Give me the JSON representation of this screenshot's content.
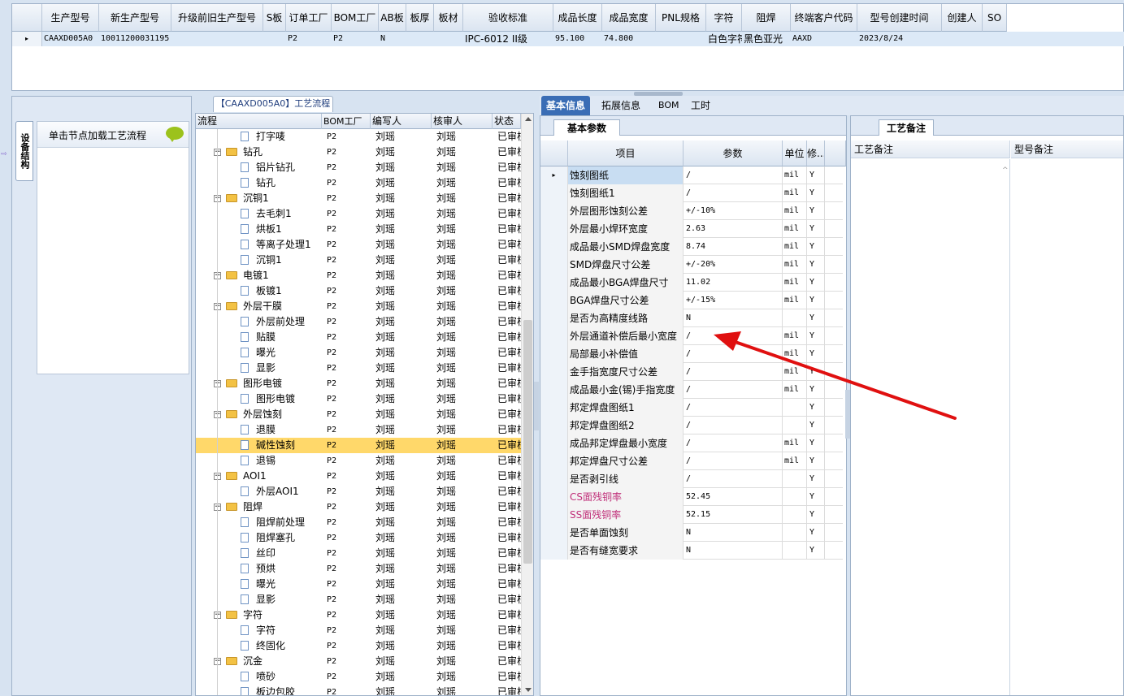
{
  "top_grid": {
    "columns": [
      "生产型号",
      "新生产型号",
      "升级前旧生产型号",
      "S板",
      "订单工厂",
      "BOM工厂",
      "AB板",
      "板厚",
      "板材",
      "验收标准",
      "成品长度",
      "成品宽度",
      "PNL规格",
      "字符",
      "阻焊",
      "终端客户代码",
      "型号创建时间",
      "创建人",
      "SO"
    ],
    "row": [
      "CAAXD005A0",
      "10011200031195",
      "",
      "",
      "P2",
      "P2",
      "N",
      "",
      "",
      "IPC-6012 II级",
      "95.100",
      "74.800",
      "",
      "白色字符",
      "黑色亚光",
      "AAXD",
      "2023/8/24",
      "",
      ""
    ]
  },
  "left_panel": {
    "vertical_tab": "设备结构",
    "hint": "单击节点加载工艺流程"
  },
  "process": {
    "title": "【CAAXD005A0】工艺流程",
    "columns": [
      "流程",
      "BOM工厂",
      "编写人",
      "核审人",
      "状态"
    ],
    "rows": [
      {
        "name": "打字唛",
        "level": 1,
        "factory": "P2",
        "writer": "刘瑶",
        "checker": "刘瑶",
        "status": "已审核"
      },
      {
        "name": "钻孔",
        "level": 0,
        "factory": "P2",
        "writer": "刘瑶",
        "checker": "刘瑶",
        "status": "已审核"
      },
      {
        "name": "铝片钻孔",
        "level": 1,
        "factory": "P2",
        "writer": "刘瑶",
        "checker": "刘瑶",
        "status": "已审核"
      },
      {
        "name": "钻孔",
        "level": 1,
        "factory": "P2",
        "writer": "刘瑶",
        "checker": "刘瑶",
        "status": "已审核"
      },
      {
        "name": "沉铜1",
        "level": 0,
        "factory": "P2",
        "writer": "刘瑶",
        "checker": "刘瑶",
        "status": "已审核"
      },
      {
        "name": "去毛刺1",
        "level": 1,
        "factory": "P2",
        "writer": "刘瑶",
        "checker": "刘瑶",
        "status": "已审核"
      },
      {
        "name": "烘板1",
        "level": 1,
        "factory": "P2",
        "writer": "刘瑶",
        "checker": "刘瑶",
        "status": "已审核"
      },
      {
        "name": "等离子处理1",
        "level": 1,
        "factory": "P2",
        "writer": "刘瑶",
        "checker": "刘瑶",
        "status": "已审核"
      },
      {
        "name": "沉铜1",
        "level": 1,
        "factory": "P2",
        "writer": "刘瑶",
        "checker": "刘瑶",
        "status": "已审核"
      },
      {
        "name": "电镀1",
        "level": 0,
        "factory": "P2",
        "writer": "刘瑶",
        "checker": "刘瑶",
        "status": "已审核"
      },
      {
        "name": "板镀1",
        "level": 1,
        "factory": "P2",
        "writer": "刘瑶",
        "checker": "刘瑶",
        "status": "已审核"
      },
      {
        "name": "外层干膜",
        "level": 0,
        "factory": "P2",
        "writer": "刘瑶",
        "checker": "刘瑶",
        "status": "已审核"
      },
      {
        "name": "外层前处理",
        "level": 1,
        "factory": "P2",
        "writer": "刘瑶",
        "checker": "刘瑶",
        "status": "已审核"
      },
      {
        "name": "贴膜",
        "level": 1,
        "factory": "P2",
        "writer": "刘瑶",
        "checker": "刘瑶",
        "status": "已审核"
      },
      {
        "name": "曝光",
        "level": 1,
        "factory": "P2",
        "writer": "刘瑶",
        "checker": "刘瑶",
        "status": "已审核"
      },
      {
        "name": "显影",
        "level": 1,
        "factory": "P2",
        "writer": "刘瑶",
        "checker": "刘瑶",
        "status": "已审核"
      },
      {
        "name": "图形电镀",
        "level": 0,
        "factory": "P2",
        "writer": "刘瑶",
        "checker": "刘瑶",
        "status": "已审核"
      },
      {
        "name": "图形电镀",
        "level": 1,
        "factory": "P2",
        "writer": "刘瑶",
        "checker": "刘瑶",
        "status": "已审核"
      },
      {
        "name": "外层蚀刻",
        "level": 0,
        "factory": "P2",
        "writer": "刘瑶",
        "checker": "刘瑶",
        "status": "已审核"
      },
      {
        "name": "退膜",
        "level": 1,
        "factory": "P2",
        "writer": "刘瑶",
        "checker": "刘瑶",
        "status": "已审核"
      },
      {
        "name": "碱性蚀刻",
        "level": 1,
        "factory": "P2",
        "writer": "刘瑶",
        "checker": "刘瑶",
        "status": "已审核",
        "selected": true
      },
      {
        "name": "退锡",
        "level": 1,
        "factory": "P2",
        "writer": "刘瑶",
        "checker": "刘瑶",
        "status": "已审核"
      },
      {
        "name": "AOI1",
        "level": 0,
        "factory": "P2",
        "writer": "刘瑶",
        "checker": "刘瑶",
        "status": "已审核"
      },
      {
        "name": "外层AOI1",
        "level": 1,
        "factory": "P2",
        "writer": "刘瑶",
        "checker": "刘瑶",
        "status": "已审核"
      },
      {
        "name": "阻焊",
        "level": 0,
        "factory": "P2",
        "writer": "刘瑶",
        "checker": "刘瑶",
        "status": "已审核"
      },
      {
        "name": "阻焊前处理",
        "level": 1,
        "factory": "P2",
        "writer": "刘瑶",
        "checker": "刘瑶",
        "status": "已审核"
      },
      {
        "name": "阻焊塞孔",
        "level": 1,
        "factory": "P2",
        "writer": "刘瑶",
        "checker": "刘瑶",
        "status": "已审核"
      },
      {
        "name": "丝印",
        "level": 1,
        "factory": "P2",
        "writer": "刘瑶",
        "checker": "刘瑶",
        "status": "已审核"
      },
      {
        "name": "预烘",
        "level": 1,
        "factory": "P2",
        "writer": "刘瑶",
        "checker": "刘瑶",
        "status": "已审核"
      },
      {
        "name": "曝光",
        "level": 1,
        "factory": "P2",
        "writer": "刘瑶",
        "checker": "刘瑶",
        "status": "已审核"
      },
      {
        "name": "显影",
        "level": 1,
        "factory": "P2",
        "writer": "刘瑶",
        "checker": "刘瑶",
        "status": "已审核"
      },
      {
        "name": "字符",
        "level": 0,
        "factory": "P2",
        "writer": "刘瑶",
        "checker": "刘瑶",
        "status": "已审核"
      },
      {
        "name": "字符",
        "level": 1,
        "factory": "P2",
        "writer": "刘瑶",
        "checker": "刘瑶",
        "status": "已审核"
      },
      {
        "name": "终固化",
        "level": 1,
        "factory": "P2",
        "writer": "刘瑶",
        "checker": "刘瑶",
        "status": "已审核"
      },
      {
        "name": "沉金",
        "level": 0,
        "factory": "P2",
        "writer": "刘瑶",
        "checker": "刘瑶",
        "status": "已审核"
      },
      {
        "name": "喷砂",
        "level": 1,
        "factory": "P2",
        "writer": "刘瑶",
        "checker": "刘瑶",
        "status": "已审核"
      },
      {
        "name": "板边包胶",
        "level": 1,
        "factory": "P2",
        "writer": "刘瑶",
        "checker": "刘瑶",
        "status": "已审核"
      }
    ]
  },
  "tabs": [
    "基本信息",
    "拓展信息",
    "BOM",
    "工时"
  ],
  "params": {
    "subtab": "基本参数",
    "columns": [
      "项目",
      "参数",
      "单位",
      "修..."
    ],
    "rows": [
      {
        "item": "蚀刻图纸",
        "value": "/",
        "unit": "mil",
        "flag": "Y"
      },
      {
        "item": "蚀刻图纸1",
        "value": "/",
        "unit": "mil",
        "flag": "Y"
      },
      {
        "item": "外层图形蚀刻公差",
        "value": "+/-10%",
        "unit": "mil",
        "flag": "Y"
      },
      {
        "item": "外层最小焊环宽度",
        "value": "2.63",
        "unit": "mil",
        "flag": "Y"
      },
      {
        "item": "成品最小SMD焊盘宽度",
        "value": "8.74",
        "unit": "mil",
        "flag": "Y"
      },
      {
        "item": "SMD焊盘尺寸公差",
        "value": "+/-20%",
        "unit": "mil",
        "flag": "Y"
      },
      {
        "item": "成品最小BGA焊盘尺寸",
        "value": "11.02",
        "unit": "mil",
        "flag": "Y"
      },
      {
        "item": "BGA焊盘尺寸公差",
        "value": "+/-15%",
        "unit": "mil",
        "flag": "Y"
      },
      {
        "item": "是否为高精度线路",
        "value": "N",
        "unit": "",
        "flag": "Y"
      },
      {
        "item": "外层通道补偿后最小宽度",
        "value": "/",
        "unit": "mil",
        "flag": "Y"
      },
      {
        "item": "局部最小补偿值",
        "value": "/",
        "unit": "mil",
        "flag": "Y"
      },
      {
        "item": "金手指宽度尺寸公差",
        "value": "/",
        "unit": "mil",
        "flag": "Y"
      },
      {
        "item": "成品最小金(锡)手指宽度",
        "value": "/",
        "unit": "mil",
        "flag": "Y"
      },
      {
        "item": "邦定焊盘图纸1",
        "value": "/",
        "unit": "",
        "flag": "Y"
      },
      {
        "item": "邦定焊盘图纸2",
        "value": "/",
        "unit": "",
        "flag": "Y"
      },
      {
        "item": "成品邦定焊盘最小宽度",
        "value": "/",
        "unit": "mil",
        "flag": "Y"
      },
      {
        "item": "邦定焊盘尺寸公差",
        "value": "/",
        "unit": "mil",
        "flag": "Y"
      },
      {
        "item": "是否剥引线",
        "value": "/",
        "unit": "",
        "flag": "Y"
      },
      {
        "item": "CS面残铜率",
        "value": "52.45",
        "unit": "",
        "flag": "Y",
        "pink": true
      },
      {
        "item": "SS面残铜率",
        "value": "52.15",
        "unit": "",
        "flag": "Y",
        "pink": true
      },
      {
        "item": "是否单面蚀刻",
        "value": "N",
        "unit": "",
        "flag": "Y"
      },
      {
        "item": "是否有缝宽要求",
        "value": "N",
        "unit": "",
        "flag": "Y"
      }
    ]
  },
  "notes": {
    "tab": "工艺备注",
    "col1": "工艺备注",
    "col2": "型号备注"
  },
  "colors": {
    "selected": "#ffd86a",
    "pink": "#c0307a",
    "arrow": "#e01010",
    "tab_active": "#3a6db5"
  }
}
